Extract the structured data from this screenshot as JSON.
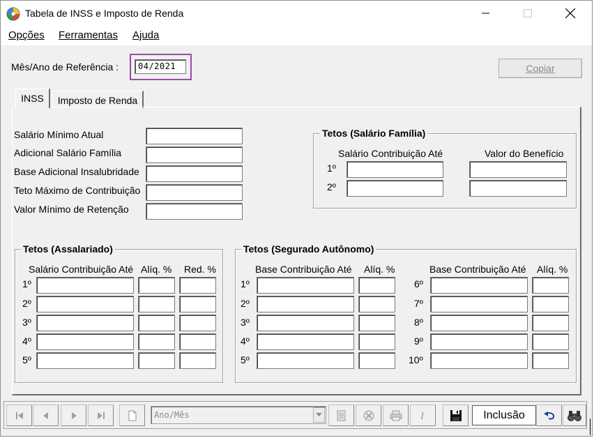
{
  "window": {
    "title": "Tabela de INSS e Imposto de Renda"
  },
  "menu": {
    "opcoes": "Opções",
    "ferramentas": "Ferramentas",
    "ajuda": "Ajuda"
  },
  "reference": {
    "label": "Mês/Ano de Referência :",
    "value": "04/2021"
  },
  "copy_label": "Copiar",
  "tabs": {
    "inss": "INSS",
    "ir": "Imposto de Renda"
  },
  "inss": {
    "fields": [
      "Salário Mínimo Atual",
      "Adicional Salário Família",
      "Base Adicional Insalubridade",
      "Teto Máximo de Contribuição",
      "Valor Mínimo de Retenção"
    ],
    "familia": {
      "title": "Tetos (Salário Família)",
      "col1": "Salário Contribuição Até",
      "col2": "Valor do Benefício",
      "rows": [
        "1º",
        "2º"
      ]
    },
    "assalariado": {
      "title": "Tetos (Assalariado)",
      "col1": "Salário Contribuição Até",
      "col2": "Alíq. %",
      "col3": "Red. %",
      "rows": [
        "1º",
        "2º",
        "3º",
        "4º",
        "5º"
      ]
    },
    "autonomo": {
      "title": "Tetos (Segurado Autônomo)",
      "col1": "Base Contribuição Até",
      "col2": "Alíq. %",
      "col3": "Base Contribuição Até",
      "col4": "Alíq. %",
      "rows_left": [
        "1º",
        "2º",
        "3º",
        "4º",
        "5º"
      ],
      "rows_right": [
        "6º",
        "7º",
        "8º",
        "9º",
        "10º"
      ]
    }
  },
  "toolbar": {
    "combo_value": "Ano/Mês",
    "status": "Inclusão",
    "icons": [
      "first-record-icon",
      "prev-record-icon",
      "next-record-icon",
      "last-record-icon",
      "new-document-icon",
      "edit-icon",
      "delete-icon",
      "print-icon",
      "italic-icon",
      "save-icon",
      "undo-icon",
      "binoculars-icon"
    ]
  }
}
